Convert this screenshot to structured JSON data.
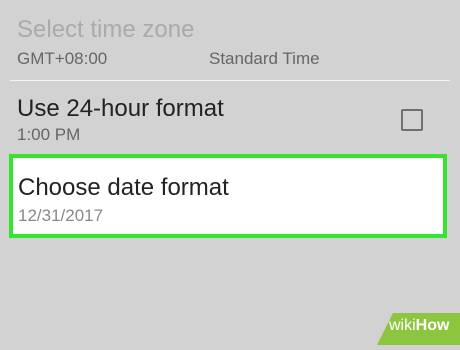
{
  "settings": {
    "time_zone": {
      "title": "Select time zone",
      "offset": "GMT+08:00",
      "name": "Standard Time"
    },
    "hour_format": {
      "title": "Use 24-hour format",
      "example": "1:00 PM",
      "checked": false
    },
    "date_format": {
      "title": "Choose date format",
      "example": "12/31/2017",
      "highlight_color": "#34e431"
    }
  },
  "watermark": {
    "text": "wikiHow",
    "prefix": "wiki",
    "suffix": "How",
    "color": "#8cc63f"
  }
}
